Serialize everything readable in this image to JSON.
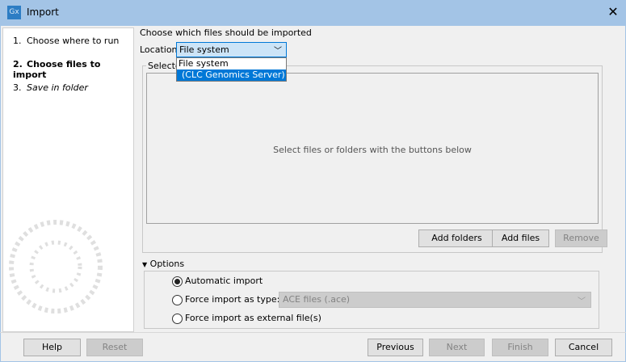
{
  "window": {
    "title": "Import",
    "icon_text": "Gx",
    "close_icon": "close-icon"
  },
  "steps": [
    {
      "num": "1.",
      "label": "Choose where to run",
      "style": "normal"
    },
    {
      "num": "2.",
      "label": "Choose files to import",
      "style": "bold"
    },
    {
      "num": "3.",
      "label": "Save in folder",
      "style": "italic"
    }
  ],
  "main": {
    "heading": "Choose which files should be imported",
    "location_label": "Location",
    "location_value": "File system",
    "location_options": [
      "File system",
      "(CLC Genomics Server)"
    ],
    "selected_group_label": "Selected files",
    "file_list_hint": "Select files or folders with the buttons below",
    "add_folders": "Add folders",
    "add_files": "Add files",
    "remove": "Remove"
  },
  "options": {
    "label": "Options",
    "automatic": "Automatic import",
    "force_type": "Force import as type:",
    "force_type_value": "ACE files (.ace)",
    "force_external": "Force import as external file(s)",
    "selected": "automatic"
  },
  "footer": {
    "help": "Help",
    "reset": "Reset",
    "previous": "Previous",
    "next": "Next",
    "finish": "Finish",
    "cancel": "Cancel"
  },
  "colors": {
    "accent": "#0078d7",
    "titlebar": "#a3c4e6"
  }
}
